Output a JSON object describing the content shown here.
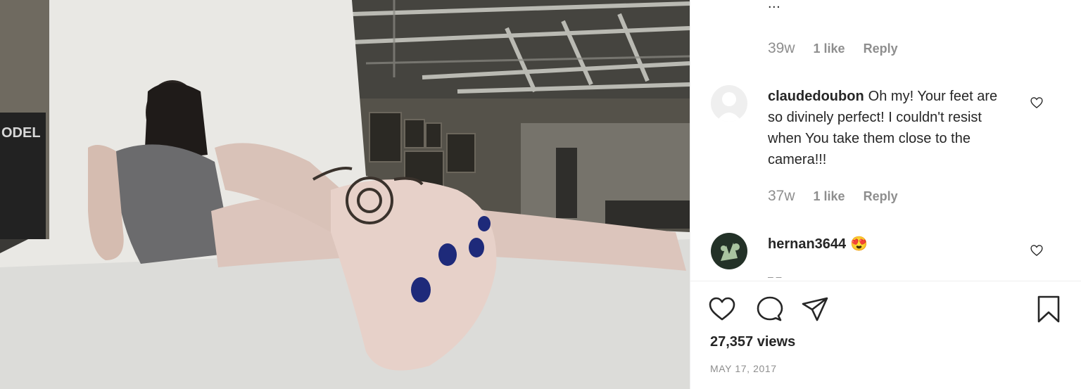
{
  "media": {
    "watermark_text": "ODEL"
  },
  "comments": {
    "clipped_previous_text": "...",
    "first_meta": {
      "time": "39w",
      "likes": "1 like",
      "reply": "Reply"
    },
    "items": [
      {
        "username": "claudedoubon",
        "text": "Oh my! Your feet are so divinely perfect! I couldn't resist when You take them close to the camera!!!",
        "time": "37w",
        "likes": "1 like",
        "reply": "Reply"
      },
      {
        "username": "hernan3644",
        "text": "😍"
      }
    ],
    "more_indicator": "– –"
  },
  "footer": {
    "views": "27,357 views",
    "date": "MAY 17, 2017"
  },
  "icons": {
    "like": "heart-icon",
    "comment": "comment-bubble-icon",
    "share": "paper-plane-icon",
    "save": "bookmark-icon",
    "comment_like": "heart-outline-icon"
  },
  "colors": {
    "text": "#262626",
    "muted": "#8e8e8e",
    "border": "#efefef"
  }
}
